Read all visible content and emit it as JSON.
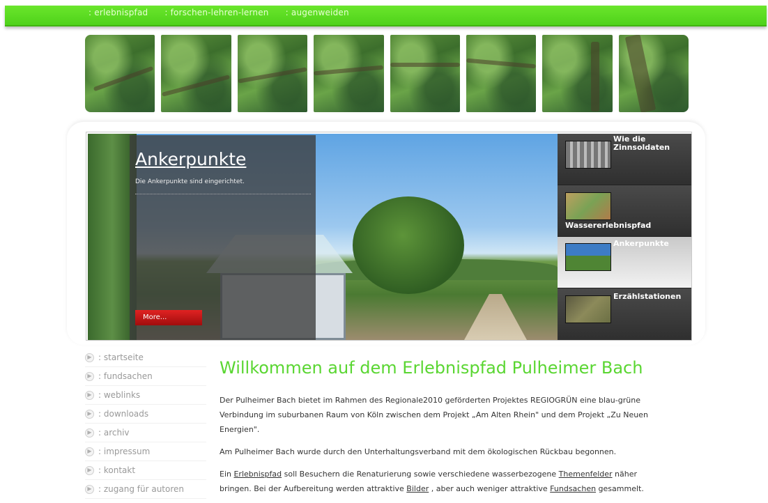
{
  "topnav": [
    "erlebnispfad",
    "forschen-lehren-lernen",
    "augenweiden"
  ],
  "topnav_prefix": ": ",
  "slider": {
    "caption_title": "Ankerpunkte",
    "caption_text": "Die Ankerpunkte sind eingerichtet.",
    "more_label": "More...",
    "thumbs": [
      {
        "label": "Wie die Zinnsoldaten",
        "active": false
      },
      {
        "label": "Wassererlebnispfad",
        "active": false
      },
      {
        "label": "Ankerpunkte",
        "active": true
      },
      {
        "label": "Erzählstationen",
        "active": false
      }
    ]
  },
  "sidenav": [
    ": startseite",
    ": fundsachen",
    ": weblinks",
    ": downloads",
    ": archiv",
    ": impressum",
    ": kontakt",
    ": zugang für autoren"
  ],
  "main": {
    "title": "Willkommen auf dem Erlebnispfad Pulheimer Bach",
    "para1": "Der Pulheimer Bach bietet im Rahmen des Regionale2010 geförderten Projektes REGIOGRÜN eine blau-grüne Verbindung im suburbanen Raum von Köln zwischen dem Projekt „Am Alten Rhein\" und dem Projekt „Zu Neuen Energien\".",
    "para2": "Am Pulheimer Bach wurde durch den Unterhaltungsverband mit dem ökologischen Rückbau begonnen.",
    "para3": {
      "t1": "Ein ",
      "link1": "Erlebnispfad",
      "t2": " soll Besuchern die Renaturierung sowie verschiedene wasserbezogene ",
      "link2": "Themenfelder",
      "t3": " näher bringen. Bei der Aufbereitung werden attraktive ",
      "link3": "Bilder",
      "t4": " , aber auch weniger attraktive ",
      "link4": "Fundsachen",
      "t5": " gesammelt."
    }
  },
  "colors": {
    "nav_green": "#4fd21a",
    "title_green": "#5ad632",
    "more_red": "#c41414"
  }
}
